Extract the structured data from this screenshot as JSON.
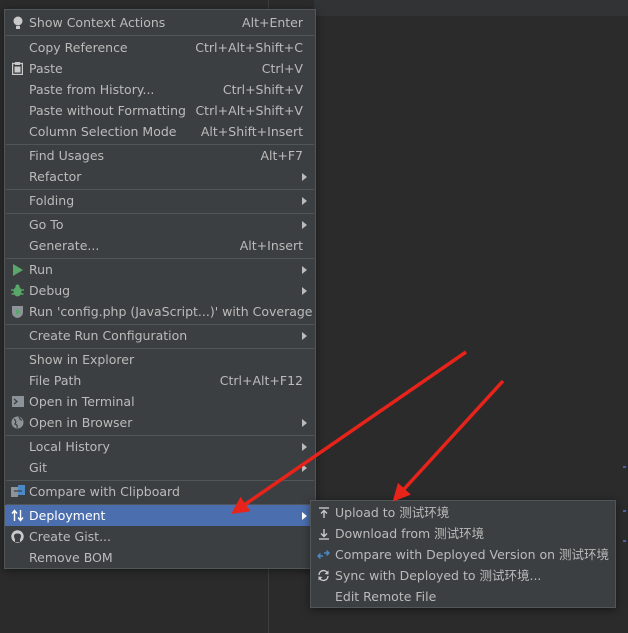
{
  "context_menu": {
    "items": [
      {
        "label": "Show Context Actions",
        "shortcut": "Alt+Enter",
        "icon": "bulb-icon"
      },
      {
        "label": "Copy Reference",
        "shortcut": "Ctrl+Alt+Shift+C"
      },
      {
        "label": "Paste",
        "shortcut": "Ctrl+V",
        "icon": "clipboard-icon"
      },
      {
        "label": "Paste from History...",
        "shortcut": "Ctrl+Shift+V"
      },
      {
        "label": "Paste without Formatting",
        "shortcut": "Ctrl+Alt+Shift+V"
      },
      {
        "label": "Column Selection Mode",
        "shortcut": "Alt+Shift+Insert"
      },
      {
        "label": "Find Usages",
        "shortcut": "Alt+F7"
      },
      {
        "label": "Refactor"
      },
      {
        "label": "Folding"
      },
      {
        "label": "Go To"
      },
      {
        "label": "Generate...",
        "shortcut": "Alt+Insert"
      },
      {
        "label": "Run",
        "icon": "run-icon"
      },
      {
        "label": "Debug",
        "icon": "debug-icon"
      },
      {
        "label": "Run 'config.php (JavaScript...)' with Coverage",
        "icon": "coverage-icon"
      },
      {
        "label": "Create Run Configuration"
      },
      {
        "label": "Show in Explorer"
      },
      {
        "label": "File Path",
        "shortcut": "Ctrl+Alt+F12"
      },
      {
        "label": "Open in Terminal",
        "icon": "terminal-icon"
      },
      {
        "label": "Open in Browser",
        "icon": "globe-icon"
      },
      {
        "label": "Local History"
      },
      {
        "label": "Git"
      },
      {
        "label": "Compare with Clipboard",
        "icon": "compare-icon"
      },
      {
        "label": "Deployment",
        "icon": "deployment-icon"
      },
      {
        "label": "Create Gist...",
        "icon": "github-icon"
      },
      {
        "label": "Remove BOM"
      }
    ]
  },
  "deployment_submenu": {
    "items": [
      {
        "label": "Upload to 测试环境",
        "icon": "upload-icon"
      },
      {
        "label": "Download from 测试环境",
        "icon": "download-icon"
      },
      {
        "label": "Compare with Deployed Version on 测试环境",
        "icon": "compare-deployed-icon"
      },
      {
        "label": "Sync with Deployed to 测试环境...",
        "icon": "sync-icon"
      },
      {
        "label": "Edit Remote File"
      }
    ]
  },
  "colors": {
    "menu_bg": "#3c3f41",
    "selection": "#4b6eaf",
    "text": "#bbbbbb",
    "annotation_arrow": "#e8231a"
  }
}
